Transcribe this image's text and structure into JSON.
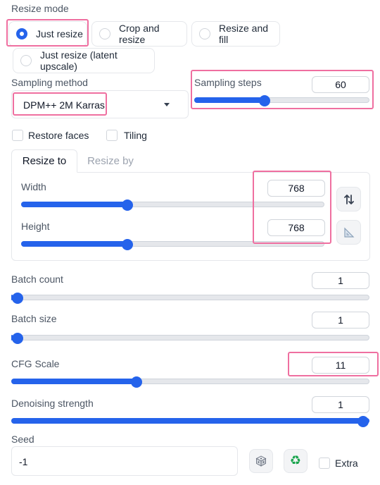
{
  "resize_mode": {
    "label": "Resize mode",
    "options": [
      "Just resize",
      "Crop and resize",
      "Resize and fill",
      "Just resize (latent upscale)"
    ],
    "selected": "Just resize"
  },
  "sampling_method": {
    "label": "Sampling method",
    "value": "DPM++ 2M Karras"
  },
  "sampling_steps": {
    "label": "Sampling steps",
    "value": "60",
    "fraction": 0.4
  },
  "checkboxes": {
    "restore_faces": "Restore faces",
    "tiling": "Tiling"
  },
  "size_tabs": {
    "tabs": [
      "Resize to",
      "Resize by"
    ],
    "active": "Resize to"
  },
  "width": {
    "label": "Width",
    "value": "768",
    "fraction": 0.35
  },
  "height": {
    "label": "Height",
    "value": "768",
    "fraction": 0.35
  },
  "batch_count": {
    "label": "Batch count",
    "value": "1",
    "fraction": 0.0
  },
  "batch_size": {
    "label": "Batch size",
    "value": "1",
    "fraction": 0.0
  },
  "cfg_scale": {
    "label": "CFG Scale",
    "value": "11",
    "fraction": 0.35
  },
  "denoising_strength": {
    "label": "Denoising strength",
    "value": "1",
    "fraction": 1.0
  },
  "seed": {
    "label": "Seed",
    "value": "-1",
    "extra_label": "Extra"
  },
  "icons": {
    "swap": "swap-arrows-icon",
    "aspect": "triangle-ruler-icon",
    "dice": "dice-icon",
    "recycle": "recycle-icon",
    "dropdown": "caret-down-icon"
  },
  "colors": {
    "accent": "#2563eb",
    "highlight_box": "#ef6fa0"
  }
}
